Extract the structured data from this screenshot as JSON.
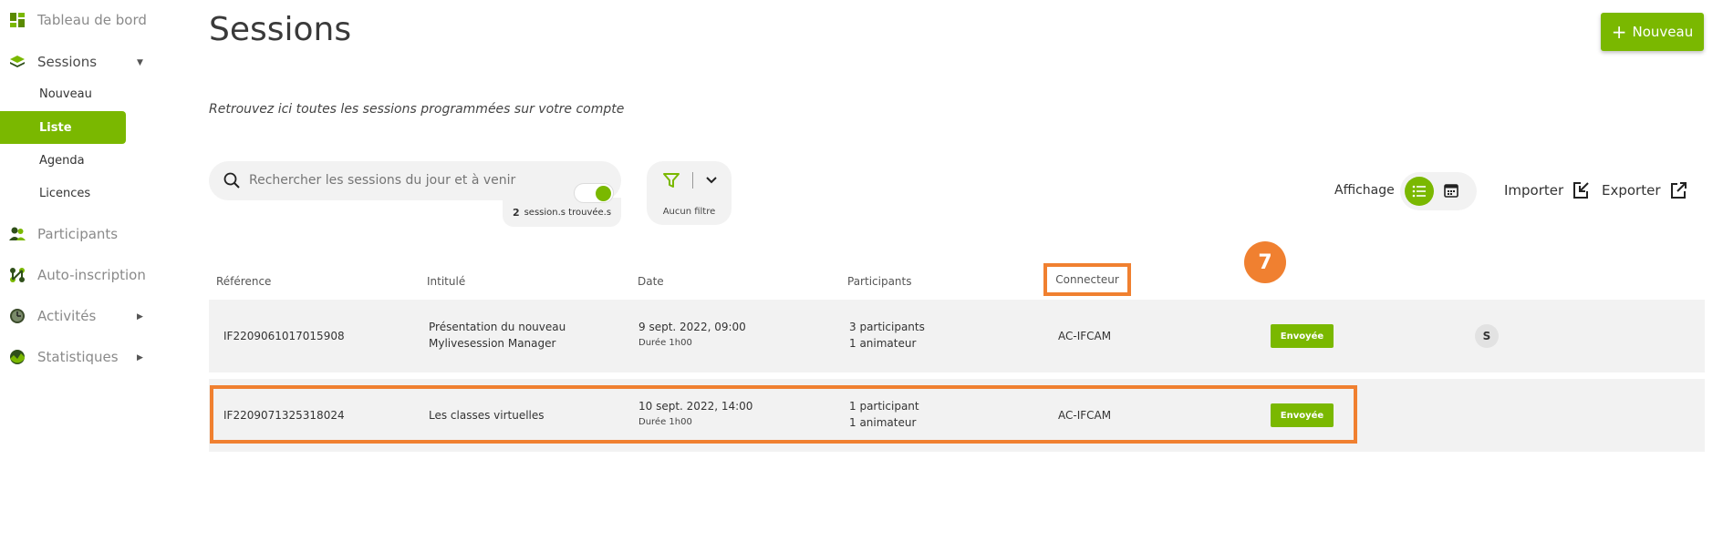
{
  "sidebar": {
    "items": [
      {
        "label": "Tableau de bord",
        "icon": "dashboard-icon"
      },
      {
        "label": "Sessions",
        "icon": "layers-icon"
      },
      {
        "label": "Participants",
        "icon": "users-icon"
      },
      {
        "label": "Auto-inscription",
        "icon": "share-icon"
      },
      {
        "label": "Activités",
        "icon": "clock-icon"
      },
      {
        "label": "Statistiques",
        "icon": "chart-icon"
      }
    ],
    "sub_items": [
      {
        "label": "Nouveau"
      },
      {
        "label": "Liste"
      },
      {
        "label": "Agenda"
      },
      {
        "label": "Licences"
      }
    ]
  },
  "header": {
    "title": "Sessions",
    "new_button": "Nouveau",
    "subtitle": "Retrouvez ici toutes les sessions programmées sur votre compte"
  },
  "search": {
    "placeholder": "Rechercher les sessions du jour et à venir",
    "count": "2",
    "count_label": "session.s trouvée.s"
  },
  "filter": {
    "label": "Aucun filtre"
  },
  "toolbar": {
    "affichage": "Affichage",
    "importer": "Importer",
    "exporter": "Exporter"
  },
  "table": {
    "headers": [
      "Référence",
      "Intitulé",
      "Date",
      "Participants",
      "Connecteur"
    ],
    "rows": [
      {
        "reference": "IF2209061017015908",
        "title_line1": "Présentation du nouveau",
        "title_line2": "Mylivesession Manager",
        "date": "9 sept. 2022, 09:00",
        "duration": "Durée 1h00",
        "participants": "3 participants",
        "animators": "1 animateur",
        "connector": "AC-IFCAM",
        "status": "Envoyée",
        "avatar": "S"
      },
      {
        "reference": "IF2209071325318024",
        "title_line1": "Les classes virtuelles",
        "date": "10 sept. 2022, 14:00",
        "duration": "Durée 1h00",
        "participants": "1 participant",
        "animators": "1 animateur",
        "connector": "AC-IFCAM",
        "status": "Envoyée"
      }
    ]
  },
  "annotation": {
    "step": "7"
  },
  "colors": {
    "accent": "#7ab800",
    "highlight": "#f08030",
    "row_bg": "#f2f2f2"
  }
}
